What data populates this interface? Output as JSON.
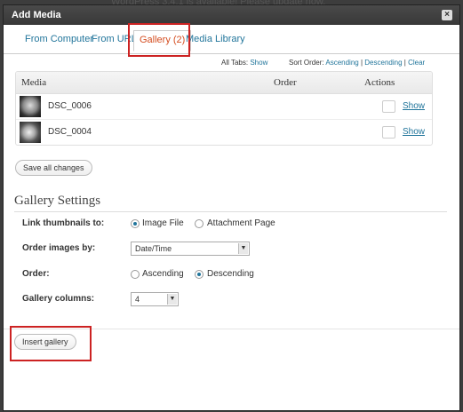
{
  "background": {
    "notice": "WordPress 3.4.1 is available! Please update now."
  },
  "dialog": {
    "title": "Add Media",
    "close_glyph": "×"
  },
  "tabs": [
    {
      "label": "From Computer",
      "active": false
    },
    {
      "label": "From URL",
      "active": false
    },
    {
      "label": "Gallery (2)",
      "active": true
    },
    {
      "label": "Media Library",
      "active": false
    }
  ],
  "sortbar": {
    "all_tabs_label": "All Tabs:",
    "show_link": "Show",
    "sort_order_label": "Sort Order:",
    "ascending_link": "Ascending",
    "separator": "|",
    "descending_link": "Descending",
    "clear_link": "Clear"
  },
  "media_table": {
    "columns": {
      "media": "Media",
      "order": "Order",
      "actions": "Actions"
    },
    "rows": [
      {
        "filename": "DSC_0006",
        "order": "",
        "action": "Show"
      },
      {
        "filename": "DSC_0004",
        "order": "",
        "action": "Show"
      }
    ]
  },
  "save_button": "Save all changes",
  "gallery_settings": {
    "title": "Gallery Settings",
    "link_thumbnails": {
      "label": "Link thumbnails to:",
      "options": [
        "Image File",
        "Attachment Page"
      ],
      "selected": "Image File"
    },
    "order_images_by": {
      "label": "Order images by:",
      "value": "Date/Time"
    },
    "order": {
      "label": "Order:",
      "options": [
        "Ascending",
        "Descending"
      ],
      "selected": "Descending"
    },
    "gallery_columns": {
      "label": "Gallery columns:",
      "value": "4"
    }
  },
  "insert_button": "Insert gallery",
  "colors": {
    "accent_link": "#21759b",
    "active_tab": "#d54e21",
    "highlight_box": "#cc2222"
  },
  "icons": {
    "close": "close-icon",
    "select_arrow": "chevron-down-icon"
  }
}
